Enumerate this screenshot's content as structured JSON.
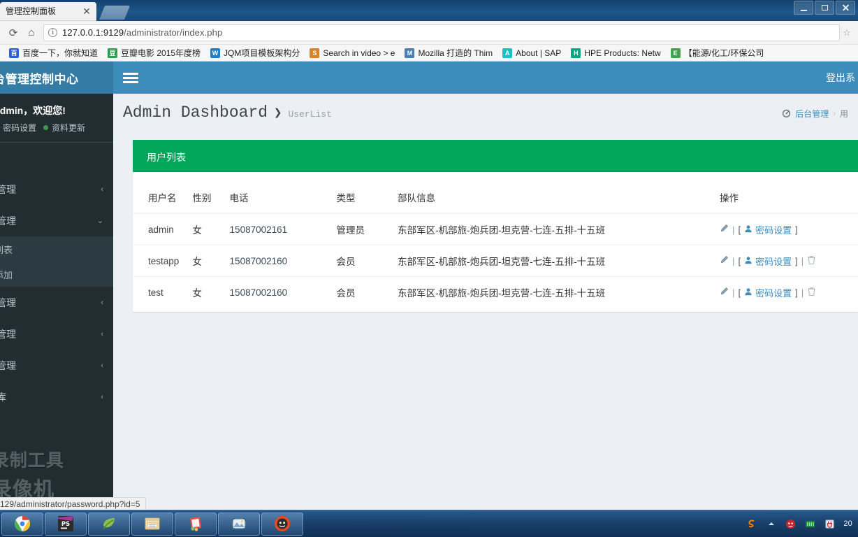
{
  "browser": {
    "tab_title": "管理控制面板",
    "tab_close": "✕",
    "url_host": "127.0.0.1:9129",
    "url_path": "/administrator/index.php",
    "reload_icon": "⟳",
    "home_icon": "⌂",
    "info_icon": "i",
    "star_icon": "☆",
    "bookmarks": [
      {
        "label": "百度一下，你就知道",
        "icon_letter": "百",
        "icon_color": "#2b5fd9"
      },
      {
        "label": "豆瓣电影 2015年度榜",
        "icon_letter": "豆",
        "icon_color": "#2e9b4e"
      },
      {
        "label": "JQM项目模板架构分",
        "icon_letter": "W",
        "icon_color": "#1f7fc4"
      },
      {
        "label": "Search in video > e",
        "icon_letter": "S",
        "icon_color": "#d9822b"
      },
      {
        "label": "Mozilla 打造的 Thim",
        "icon_letter": "M",
        "icon_color": "#4a7fb5"
      },
      {
        "label": "About | SAP",
        "icon_letter": "A",
        "icon_color": "#1fbfc7"
      },
      {
        "label": "HPE Products: Netw",
        "icon_letter": "H",
        "icon_color": "#01a982"
      },
      {
        "label": "【能源/化工/环保公司",
        "icon_letter": "E",
        "icon_color": "#3fa34d"
      }
    ],
    "status_text": "129/administrator/password.php?id=5"
  },
  "window_controls": {
    "minimize": "minimize",
    "maximize": "maximize",
    "close": "close"
  },
  "app": {
    "brand": "台管理控制中心",
    "hamburger": "menu-toggle",
    "logout": "登出系",
    "colors": {
      "header": "#3c8dbc",
      "brand": "#357ca5",
      "sidebar": "#222d32",
      "box_green": "#00a65a",
      "link": "#3c8dbc"
    }
  },
  "sidebar": {
    "welcome": "admin，欢迎您!",
    "user_links": [
      {
        "label": "密码设置"
      },
      {
        "label": "资料更新"
      }
    ],
    "menu": [
      {
        "label": "管理",
        "chevron": "‹",
        "expanded": false
      },
      {
        "label": "管理",
        "chevron": "⌄",
        "expanded": true
      },
      {
        "label": "管理",
        "chevron": "‹",
        "expanded": false
      },
      {
        "label": "管理",
        "chevron": "‹",
        "expanded": false
      },
      {
        "label": "管理",
        "chevron": "‹",
        "expanded": false
      },
      {
        "label": "库",
        "chevron": "‹",
        "expanded": false
      }
    ],
    "submenu": [
      {
        "label": "列表"
      },
      {
        "label": "添加"
      }
    ],
    "watermark_line1": "录制工具",
    "watermark_line2": "录像机"
  },
  "content": {
    "title": "Admin Dashboard",
    "title_separator": "❯",
    "subtitle": "UserList",
    "breadcrumb": {
      "icon": "dashboard-icon",
      "root": "后台管理",
      "separator": "›",
      "current": "用"
    },
    "box_title": "用户列表",
    "table": {
      "headers": [
        "用户名",
        "性别",
        "电话",
        "类型",
        "部队信息",
        "操作"
      ],
      "rows": [
        {
          "username": "admin",
          "sex": "女",
          "phone": "15087002161",
          "type": "管理员",
          "unit": "东部军区-机部旅-炮兵团-坦克营-七连-五排-十五班",
          "edit": "edit-icon",
          "password_label": "密码设置",
          "has_delete": false
        },
        {
          "username": "testapp",
          "sex": "女",
          "phone": "15087002160",
          "type": "会员",
          "unit": "东部军区-机部旅-炮兵团-坦克营-七连-五排-十五班",
          "edit": "edit-icon",
          "password_label": "密码设置",
          "has_delete": true
        },
        {
          "username": "test",
          "sex": "女",
          "phone": "15087002160",
          "type": "会员",
          "unit": "东部军区-机部旅-炮兵团-坦克营-七连-五排-十五班",
          "edit": "edit-icon",
          "password_label": "密码设置",
          "has_delete": true
        }
      ],
      "bracket_open": "[",
      "bracket_close": "]",
      "divider": "|"
    }
  },
  "taskbar": {
    "items": [
      {
        "name": "chrome"
      },
      {
        "name": "phpstorm"
      },
      {
        "name": "navicat"
      },
      {
        "name": "explorer"
      },
      {
        "name": "notepad"
      },
      {
        "name": "picture-viewer"
      },
      {
        "name": "firefox-variant"
      }
    ],
    "tray": [
      {
        "name": "sogou-input"
      },
      {
        "name": "show-hidden-icons"
      },
      {
        "name": "antivirus"
      },
      {
        "name": "network"
      },
      {
        "name": "usb-device"
      }
    ],
    "clock": "20"
  }
}
